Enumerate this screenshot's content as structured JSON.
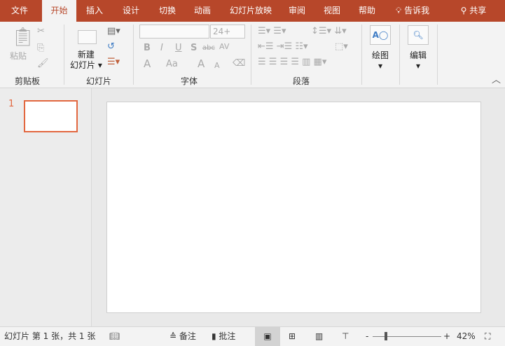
{
  "tabs": [
    {
      "label": "文件"
    },
    {
      "label": "开始",
      "active": true
    },
    {
      "label": "插入"
    },
    {
      "label": "设计"
    },
    {
      "label": "切换"
    },
    {
      "label": "动画"
    },
    {
      "label": "幻灯片放映"
    },
    {
      "label": "审阅"
    },
    {
      "label": "视图"
    },
    {
      "label": "帮助"
    }
  ],
  "tell_me": "告诉我",
  "share": "共享",
  "ribbon": {
    "clipboard": {
      "label": "剪贴板",
      "paste": "粘贴"
    },
    "slides": {
      "label": "幻灯片",
      "new_slide_1": "新建",
      "new_slide_2": "幻灯片"
    },
    "font": {
      "label": "字体",
      "font_name": "",
      "font_size": "24+",
      "bold": "B",
      "italic": "I",
      "underline": "U",
      "shadow": "S",
      "strike": "abc",
      "spacing": "AV",
      "color": "A",
      "case": "Aa",
      "grow": "A",
      "shrink": "A"
    },
    "paragraph": {
      "label": "段落"
    },
    "drawing": {
      "label": "绘图"
    },
    "editing": {
      "label": "编辑"
    }
  },
  "thumbnail_number": "1",
  "status": {
    "slide_info": "幻灯片 第 1 张，共 1 张",
    "notes": "备注",
    "comments": "批注",
    "zoom": "42%",
    "zoom_value": 42
  },
  "colors": {
    "accent": "#b7472a",
    "thumb_border": "#e2673f"
  }
}
